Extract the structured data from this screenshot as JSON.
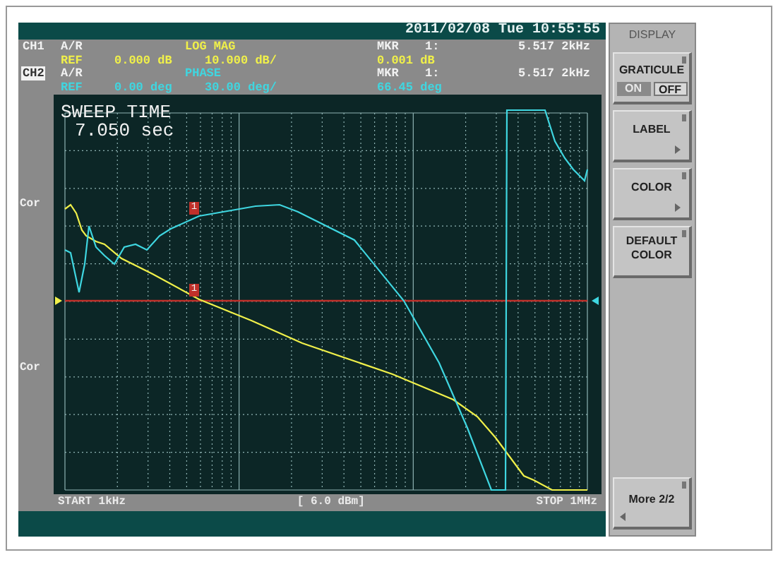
{
  "header": {
    "datetime": "2011/02/08 Tue 10:55:55"
  },
  "channels": [
    {
      "label": "CH1",
      "selected": false,
      "color": "#f0f04a",
      "param": "A/R",
      "format": "LOG MAG",
      "ref_label": "REF",
      "ref_value": "0.000 dB",
      "scale": "10.000 dB/",
      "marker_label": "MKR",
      "marker_num": "1:",
      "marker_freq": "5.517 2kHz",
      "marker_value": "0.001 dB"
    },
    {
      "label": "CH2",
      "selected": true,
      "color": "#3fd6e0",
      "param": "A/R",
      "format": "PHASE",
      "ref_label": "REF",
      "ref_value": "0.00 deg",
      "scale": "30.00 deg/",
      "marker_label": "MKR",
      "marker_num": "1:",
      "marker_freq": "5.517 2kHz",
      "marker_value": "66.45 deg"
    }
  ],
  "plot": {
    "overlay_title": "SWEEP TIME",
    "overlay_value": "7.050 sec",
    "side_labels": [
      "Cor",
      "Cor"
    ],
    "markers": [
      "1",
      "1"
    ]
  },
  "footer": {
    "start": "START 1kHz",
    "power": "[ 6.0 dBm]",
    "stop": "STOP 1MHz"
  },
  "softkeys": {
    "title": "DISPLAY",
    "keys": [
      {
        "kind": "toggle",
        "label": "GRATICULE",
        "options": [
          {
            "label": "ON",
            "selected": true
          },
          {
            "label": "OFF",
            "selected": false
          }
        ]
      },
      {
        "kind": "submenu",
        "label": "LABEL"
      },
      {
        "kind": "submenu",
        "label": "COLOR"
      },
      {
        "kind": "action",
        "label": "DEFAULT COLOR"
      },
      {
        "kind": "more",
        "label": "More 2/2"
      }
    ]
  }
}
